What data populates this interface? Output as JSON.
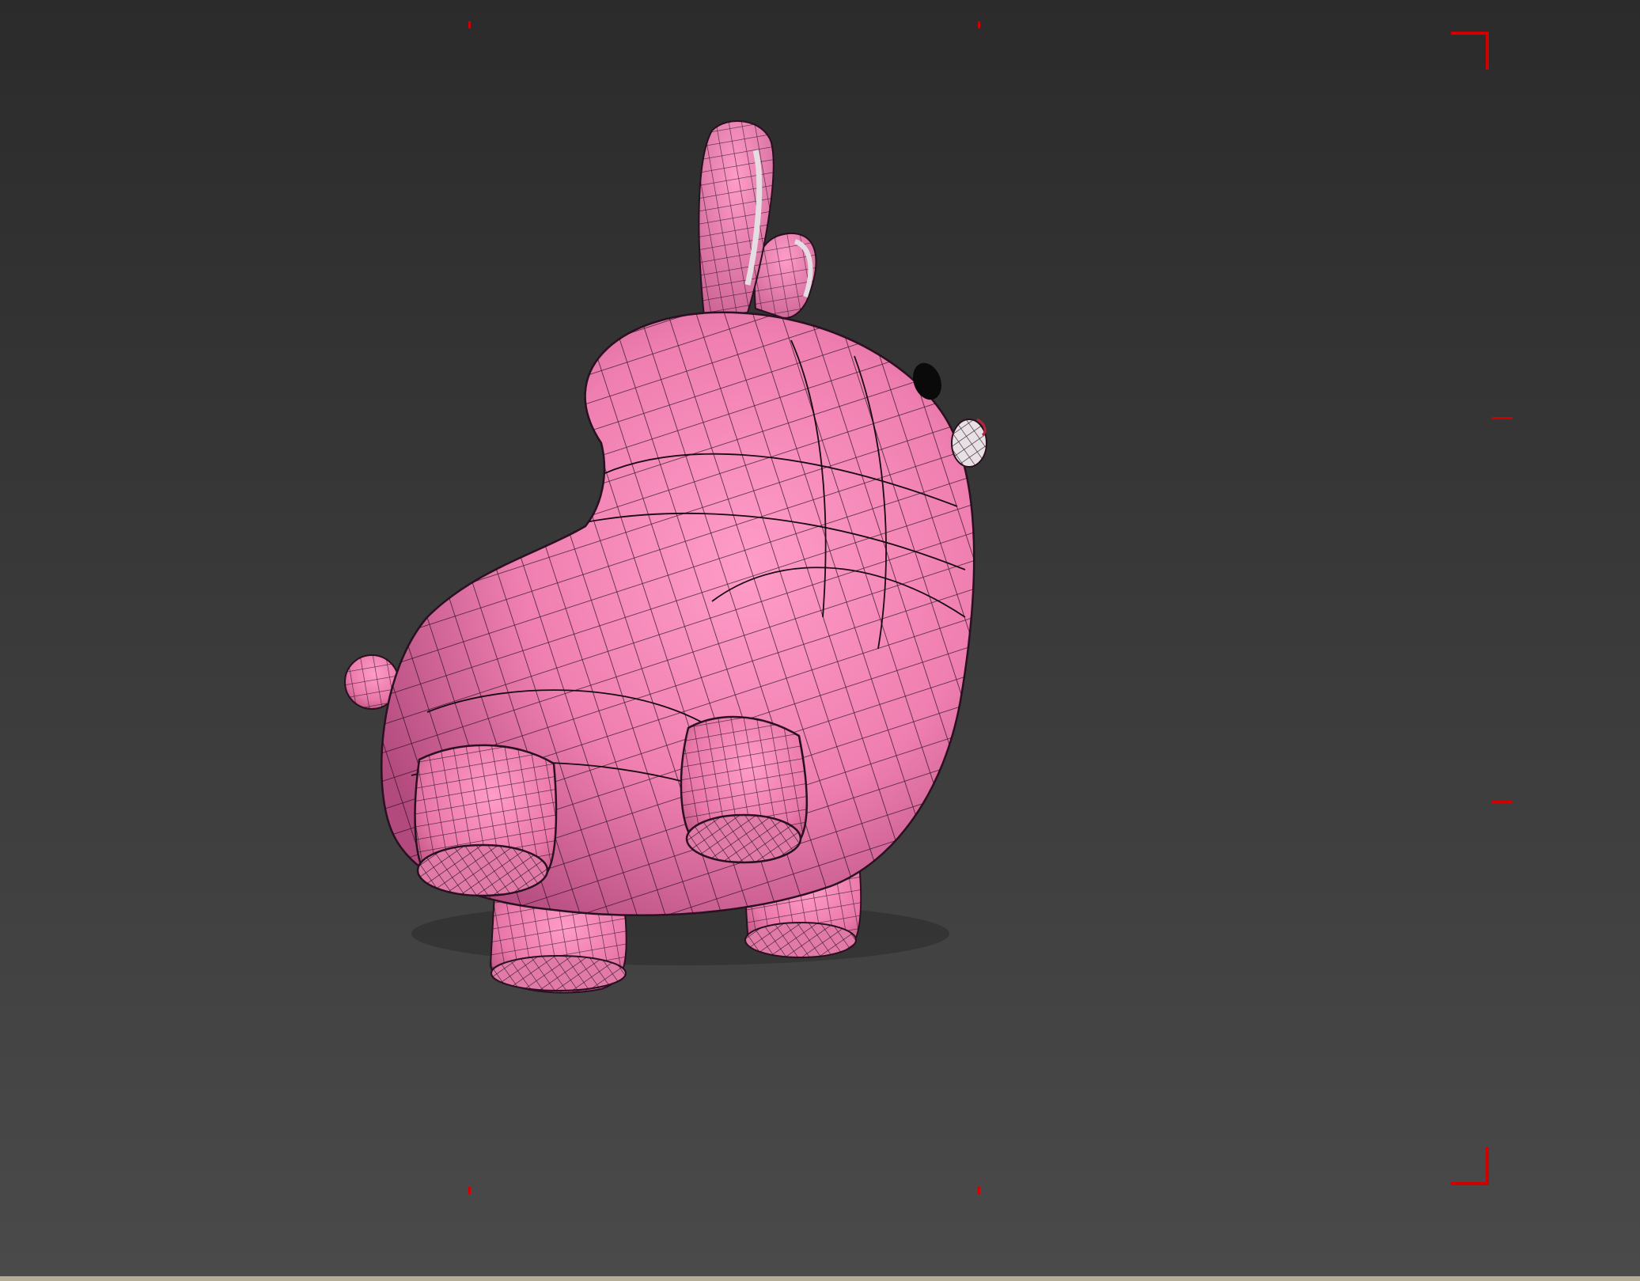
{
  "viewport": {
    "background_top": "#2b2b2b",
    "background_bottom": "#4a4a4a",
    "safe_frame_color": "#d10000",
    "bottom_border_color": "#b5ad96"
  },
  "model": {
    "name_semantic": "pink-bunny-mesh",
    "shading": "smooth-with-wireframe-overlay",
    "base_color": "#f07fb0",
    "highlight_color": "#ff9cc8",
    "shadow_color": "#b24a7e",
    "wire_color": "#1a0a12",
    "eye_color": "#0a0a0a",
    "nose_color": "#e8e0e4"
  }
}
